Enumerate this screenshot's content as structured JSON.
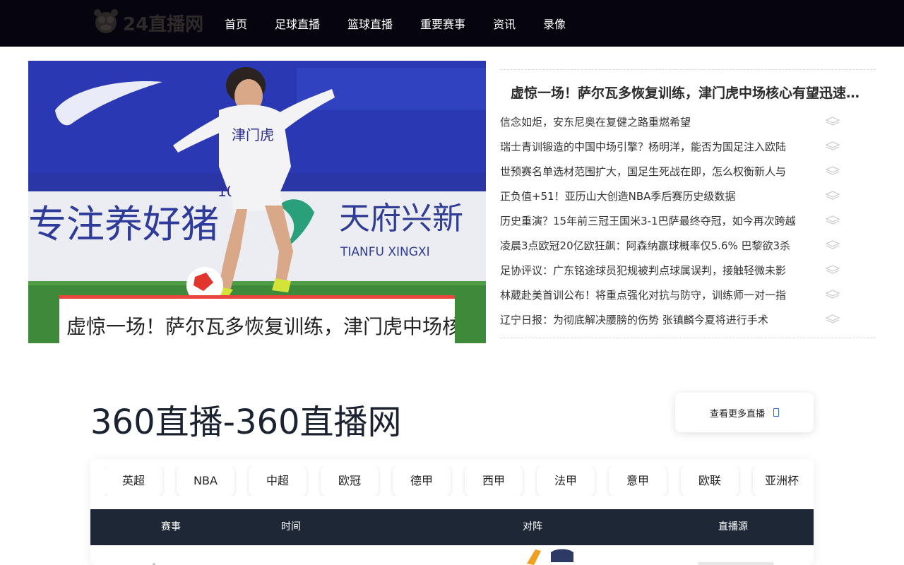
{
  "brand": {
    "logo_text": "24直播网"
  },
  "nav": {
    "items": [
      "首页",
      "足球直播",
      "篮球直播",
      "重要赛事",
      "资讯",
      "录像"
    ]
  },
  "hero": {
    "caption": "虚惊一场！萨尔瓦多恢复训练，津门虎中场核心有望迅速复出",
    "photo_texts": {
      "board_1": "专注养好猪",
      "board_2": "天府兴新",
      "board_3": "TIANFU XINGXI",
      "jersey_text": "津门虎",
      "jersey_number": "10"
    }
  },
  "news": {
    "headline": "虚惊一场！萨尔瓦多恢复训练，津门虎中场核心有望迅速复出",
    "items": [
      "信念如炬，安东尼奥在复健之路重燃希望",
      "瑞士青训锻造的中国中场引擎？杨明洋，能否为国足注入欧陆",
      "世预赛名单选材范围扩大，国足生死战在即，怎么权衡新人与",
      "正负值+51！亚历山大创造NBA季后赛历史级数据",
      "历史重演？15年前三冠王国米3-1巴萨最终夺冠，如今再次跨越",
      "凌晨3点欧冠20亿欧狂飙：阿森纳赢球概率仅5.6% 巴黎欲3杀",
      "足协评议：广东铭途球员犯规被判点球属误判，接触轻微未影",
      "林葳赴美首训公布！将重点强化对抗与防守，训练师一对一指",
      "辽宁日报：为彻底解决腰膀的伤势 张镇麟今夏将进行手术"
    ]
  },
  "section": {
    "title": "360直播-360直播网",
    "more_label": "查看更多直播"
  },
  "leagues": [
    "英超",
    "NBA",
    "中超",
    "欧冠",
    "德甲",
    "西甲",
    "法甲",
    "意甲",
    "欧联",
    "亚洲杯"
  ],
  "table": {
    "headers": [
      "赛事",
      "时间",
      "对阵",
      "直播源"
    ]
  },
  "colors": {
    "header_bg": "#06050f",
    "accent_red": "#e8463f",
    "table_head_bg": "#1e2736",
    "link_blue": "#2c6bd6"
  }
}
